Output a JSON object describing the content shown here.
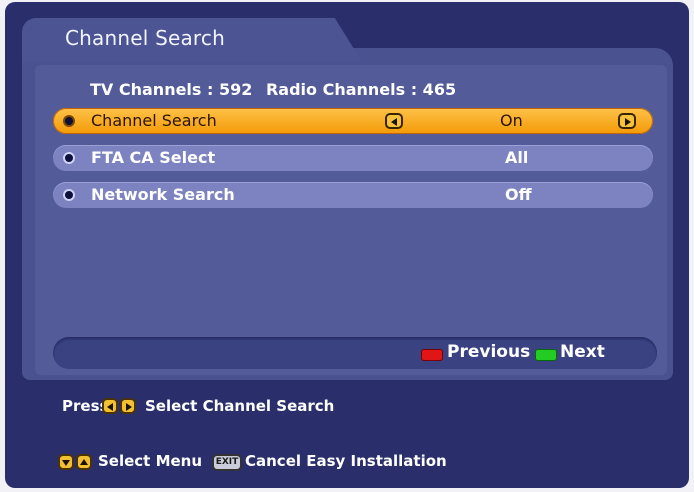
{
  "header": {
    "title": "Channel Search"
  },
  "counts": {
    "tv": "TV Channels : 592",
    "radio": "Radio Channels : 465"
  },
  "rows": [
    {
      "label": "Channel Search",
      "value": "On",
      "selected": true
    },
    {
      "label": "FTA CA Select",
      "value": "All",
      "selected": false
    },
    {
      "label": "Network Search",
      "value": "Off",
      "selected": false
    }
  ],
  "nav": {
    "previous": "Previous",
    "next": "Next"
  },
  "hints": {
    "press": "Press",
    "select_action": "Select Channel Search",
    "select_menu": "Select Menu",
    "exit_key": "EXIT",
    "cancel": "Cancel Easy Installation"
  },
  "colors": {
    "background": "#2a2f6c",
    "selected_row": "#f7a81b",
    "row": "#7c83c0",
    "red_key": "#e01515",
    "green_key": "#22cc22"
  },
  "icons": [
    "bullet-icon",
    "left-arrow-icon",
    "right-arrow-icon",
    "red-key-icon",
    "green-key-icon",
    "up-arrow-icon",
    "down-arrow-icon",
    "exit-key-icon"
  ]
}
